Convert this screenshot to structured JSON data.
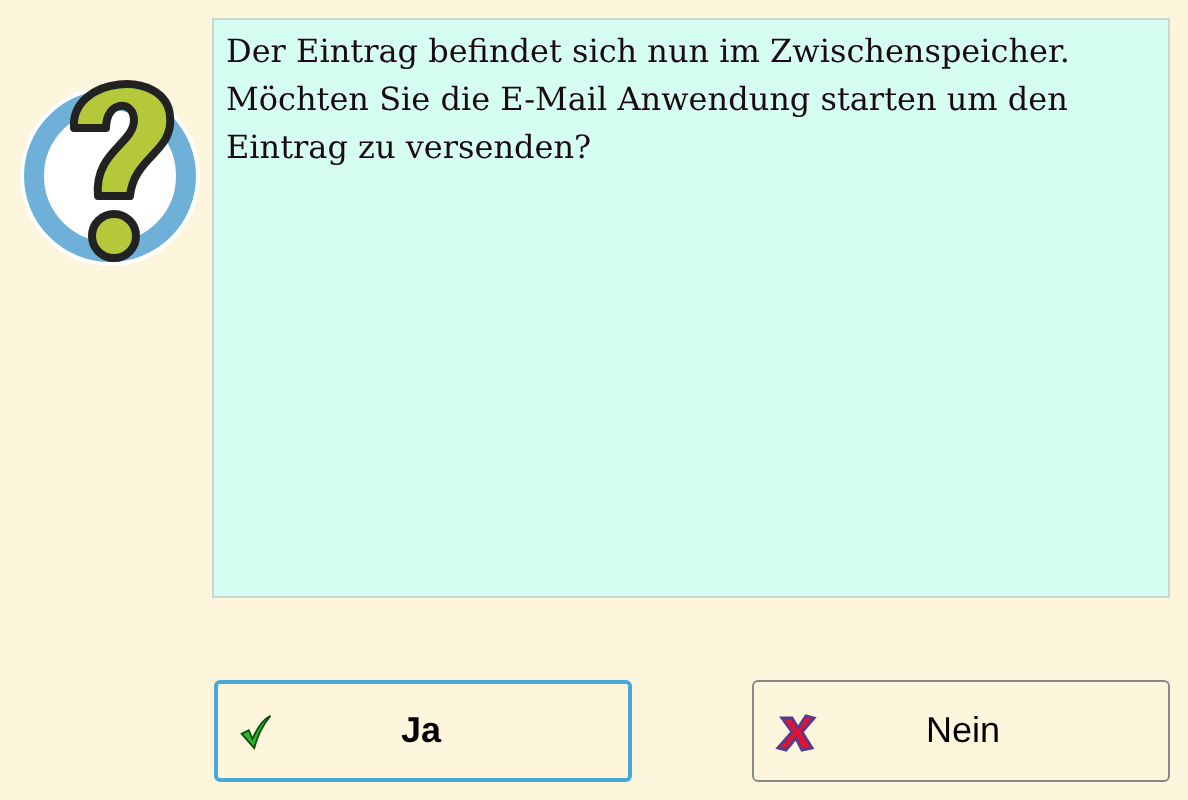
{
  "message": "Der Eintrag befindet sich nun im Zwischenspeicher. Möchten Sie die E-Mail Anwendung starten um den Eintrag zu versenden?",
  "buttons": [
    {
      "label": "Ja",
      "kind": "ok",
      "default": true
    },
    {
      "label": "Nein",
      "kind": "cancel",
      "default": false
    }
  ]
}
